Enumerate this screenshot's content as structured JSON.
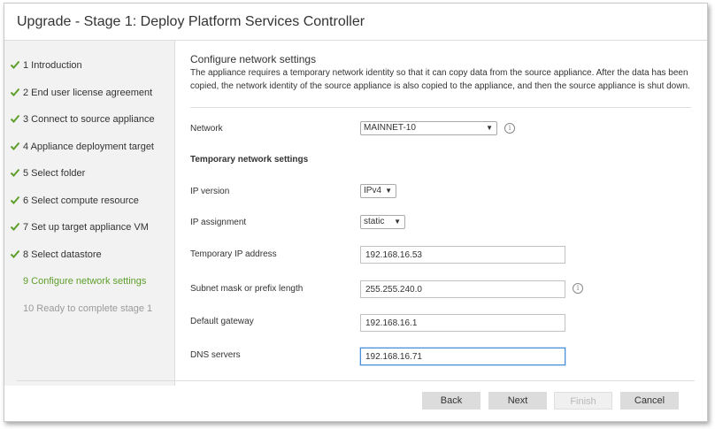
{
  "window": {
    "title": "Upgrade - Stage 1: Deploy Platform Services Controller"
  },
  "steps": [
    {
      "label": "1 Introduction",
      "state": "done"
    },
    {
      "label": "2 End user license agreement",
      "state": "done"
    },
    {
      "label": "3 Connect to source appliance",
      "state": "done"
    },
    {
      "label": "4 Appliance deployment target",
      "state": "done"
    },
    {
      "label": "5 Select folder",
      "state": "done"
    },
    {
      "label": "6 Select compute resource",
      "state": "done"
    },
    {
      "label": "7 Set up target appliance VM",
      "state": "done"
    },
    {
      "label": "8 Select datastore",
      "state": "done"
    },
    {
      "label": "9 Configure network settings",
      "state": "current"
    },
    {
      "label": "10 Ready to complete stage 1",
      "state": "future"
    }
  ],
  "main": {
    "section_title": "Configure network settings",
    "description": "The appliance requires a temporary network identity so that it can copy data from the source appliance. After the data has been copied, the network identity of the source appliance is also copied to the appliance, and then the source appliance is shut down.",
    "network": {
      "label": "Network",
      "value": "MAINNET-10"
    },
    "temp_heading": "Temporary network settings",
    "ip_version": {
      "label": "IP version",
      "value": "IPv4"
    },
    "ip_assignment": {
      "label": "IP assignment",
      "value": "static"
    },
    "temp_ip": {
      "label": "Temporary IP address",
      "value": "192.168.16.53"
    },
    "subnet": {
      "label": "Subnet mask or prefix length",
      "value": "255.255.240.0"
    },
    "gateway": {
      "label": "Default gateway",
      "value": "192.168.16.1"
    },
    "dns": {
      "label": "DNS servers",
      "value": "192.168.16.71"
    }
  },
  "buttons": {
    "back": "Back",
    "next": "Next",
    "finish": "Finish",
    "cancel": "Cancel"
  },
  "colors": {
    "check": "#5e9e2b",
    "current_step": "#5e9e2b",
    "future_step": "#9a9a9a",
    "focus": "#4a90d9"
  },
  "icons": {
    "check": "check-icon",
    "info": "info-icon",
    "dropdown": "dropdown-arrow-icon"
  }
}
